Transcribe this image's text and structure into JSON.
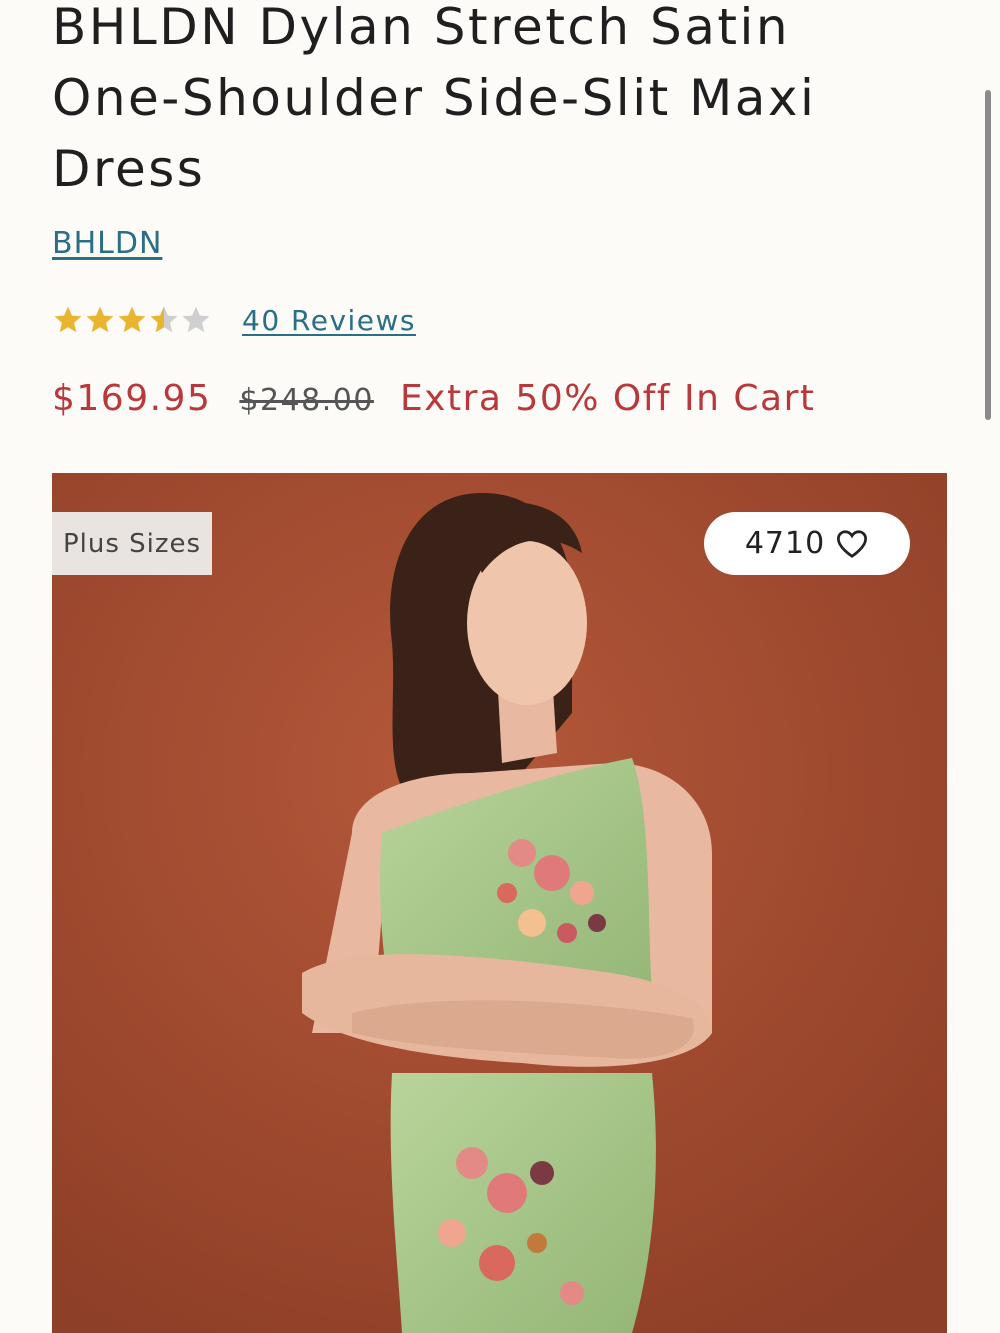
{
  "product": {
    "title": "BHLDN Dylan Stretch Satin One-Shoulder Side-Slit Maxi Dress",
    "brand": "BHLDN",
    "rating": 3.5,
    "rating_max": 5,
    "reviews_label": "40 Reviews",
    "sale_price": "$169.95",
    "original_price": "$248.00",
    "promo": "Extra 50% Off In Cart"
  },
  "image": {
    "badge": "Plus Sizes",
    "favorites_count": "4710",
    "favorite_icon": "heart-outline-icon"
  },
  "colors": {
    "link": "#2a6f86",
    "sale": "#b8383b",
    "star_filled": "#e8b52f",
    "star_empty": "#cfcfcf",
    "image_bg": "#a04a2f",
    "dress": "#a9c98a"
  }
}
